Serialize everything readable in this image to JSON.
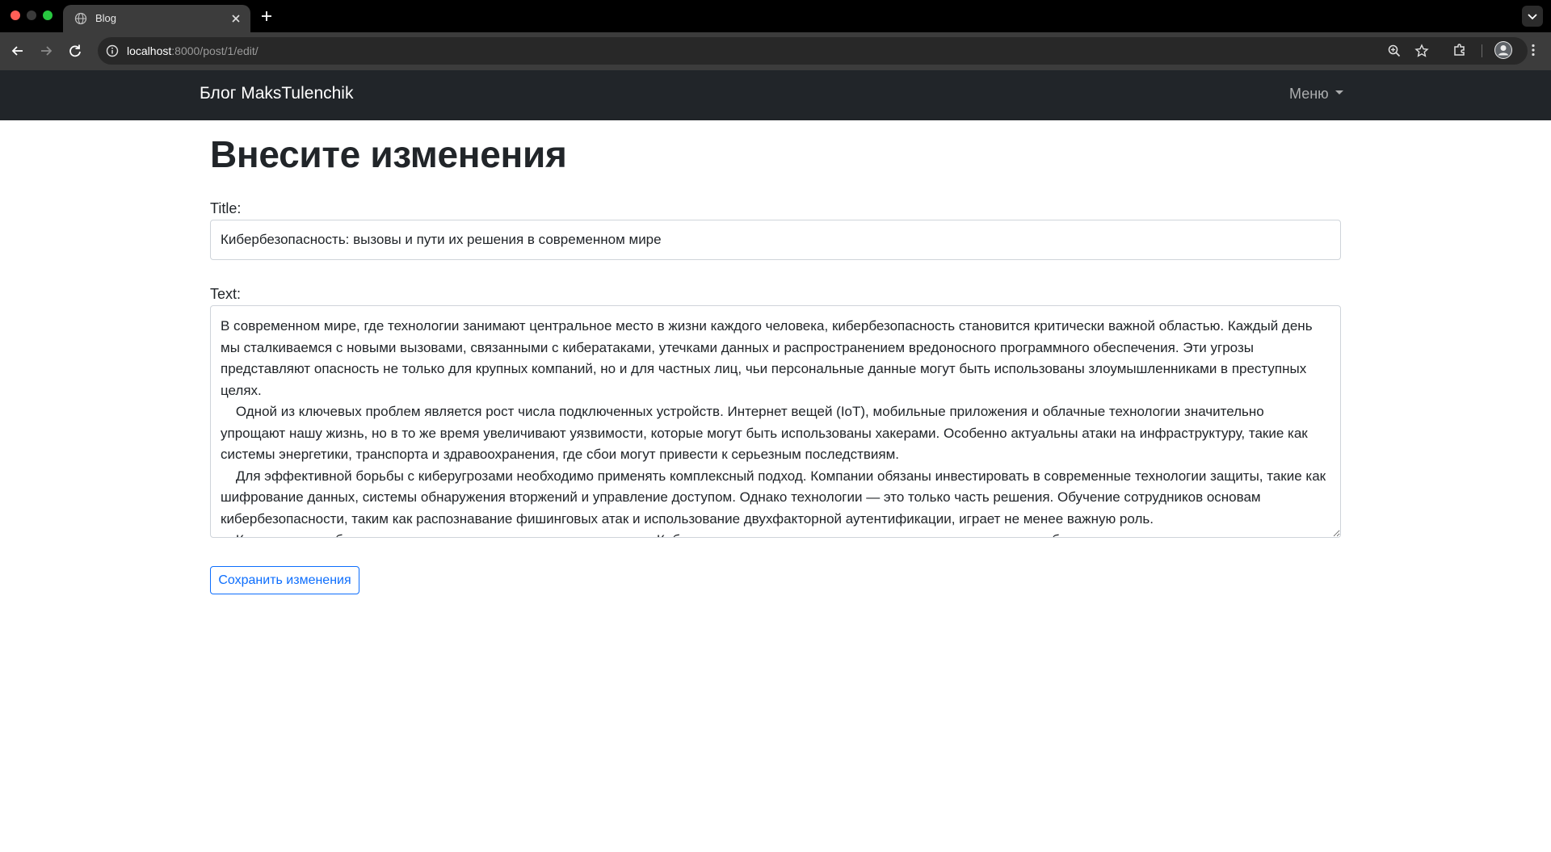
{
  "browser": {
    "tab_title": "Blog",
    "url_host": "localhost",
    "url_path": ":8000/post/1/edit/"
  },
  "navbar": {
    "brand": "Блог MaksTulenchik",
    "menu_label": "Меню"
  },
  "page": {
    "heading": "Внесите изменения",
    "title_label": "Title:",
    "title_value": "Кибербезопасность: вызовы и пути их решения в современном мире",
    "text_label": "Text:",
    "text_value": "В современном мире, где технологии занимают центральное место в жизни каждого человека, кибербезопасность становится критически важной областью. Каждый день мы сталкиваемся с новыми вызовами, связанными с кибератаками, утечками данных и распространением вредоносного программного обеспечения. Эти угрозы представляют опасность не только для крупных компаний, но и для частных лиц, чьи персональные данные могут быть использованы злоумышленниками в преступных целях.\n    Одной из ключевых проблем является рост числа подключенных устройств. Интернет вещей (IoT), мобильные приложения и облачные технологии значительно упрощают нашу жизнь, но в то же время увеличивают уязвимости, которые могут быть использованы хакерами. Особенно актуальны атаки на инфраструктуру, такие как системы энергетики, транспорта и здравоохранения, где сбои могут привести к серьезным последствиям.\n    Для эффективной борьбы с киберугрозами необходимо применять комплексный подход. Компании обязаны инвестировать в современные технологии защиты, такие как шифрование данных, системы обнаружения вторжений и управление доступом. Однако технологии — это только часть решения. Обучение сотрудников основам кибербезопасности, таким как распознавание фишинговых атак и использование двухфакторной аутентификации, играет не менее важную роль.\n    Кроме того, требуется активное международное сотрудничество. Киберугрозы не знают границ, поэтому государства должны объединять усилия для",
    "save_button": "Сохранить изменения"
  },
  "icons": {
    "tab_favicon": "globe-icon",
    "tab_close": "close-icon",
    "new_tab": "plus-icon",
    "back": "arrow-left-icon",
    "forward": "arrow-right-icon",
    "reload": "reload-icon",
    "site_info": "info-icon",
    "zoom": "zoom-icon",
    "bookmark": "star-icon",
    "extensions": "puzzle-icon",
    "profile": "profile-icon",
    "more": "kebab-icon"
  },
  "colors": {
    "navbar_bg": "#212529",
    "accent": "#0d6efd",
    "browser_chrome": "#3c3c3c"
  }
}
